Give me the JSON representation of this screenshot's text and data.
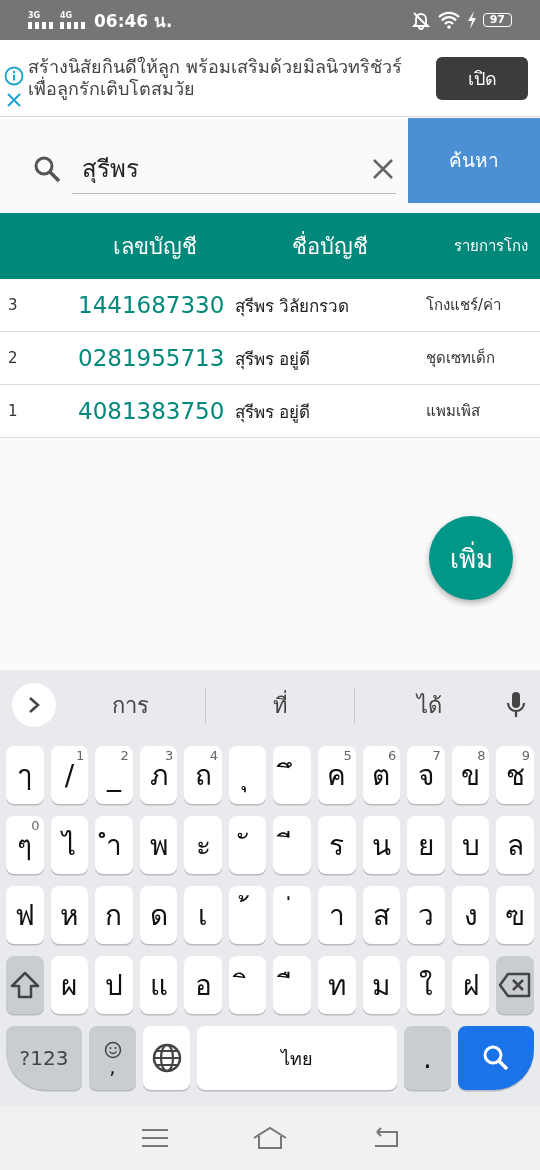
{
  "status_bar": {
    "network_1": "3G",
    "network_2": "4G",
    "time": "06:46 น.",
    "battery": "97"
  },
  "ad": {
    "text": "สร้างนิสัยกินดีให้ลูก พร้อมเสริมด้วยมิลนิวทริชัวร์เพื่อลูกรักเติบโตสมวัย",
    "button": "เปิด"
  },
  "search": {
    "value": "สุรีพร",
    "button": "ค้นหา"
  },
  "table": {
    "columns": [
      "เลขบัญชี",
      "ชื่อบัญชี",
      "รายการโกง"
    ],
    "rows": [
      {
        "no": "3",
        "account": "1441687330",
        "name": "สุรีพร วิลัยกรวด",
        "item": "โกงแชร์/ค่า"
      },
      {
        "no": "2",
        "account": "0281955713",
        "name": "สุรีพร อยู่ดี",
        "item": "ชุดเซทเด็ก"
      },
      {
        "no": "1",
        "account": "4081383750",
        "name": "สุรีพร อยู่ดี",
        "item": "แพมเพิส"
      }
    ]
  },
  "fab": "เพิ่ม",
  "keyboard": {
    "suggestions": [
      "การ",
      "ที่",
      "ได้"
    ],
    "rows": [
      [
        {
          "kind": "char",
          "label": "ๅ"
        },
        {
          "kind": "char",
          "label": "/",
          "hint": "1"
        },
        {
          "kind": "char",
          "label": "_",
          "hint": "2"
        },
        {
          "kind": "char",
          "label": "ภ",
          "hint": "3"
        },
        {
          "kind": "char",
          "label": "ถ",
          "hint": "4"
        },
        {
          "kind": "char",
          "label": "ุ"
        },
        {
          "kind": "char",
          "label": "ึ"
        },
        {
          "kind": "char",
          "label": "ค",
          "hint": "5"
        },
        {
          "kind": "char",
          "label": "ต",
          "hint": "6"
        },
        {
          "kind": "char",
          "label": "จ",
          "hint": "7"
        },
        {
          "kind": "char",
          "label": "ข",
          "hint": "8"
        },
        {
          "kind": "char",
          "label": "ช",
          "hint": "9"
        }
      ],
      [
        {
          "kind": "char",
          "label": "ๆ",
          "hint": "0"
        },
        {
          "kind": "char",
          "label": "ไ"
        },
        {
          "kind": "char",
          "label": "ำ"
        },
        {
          "kind": "char",
          "label": "พ"
        },
        {
          "kind": "char",
          "label": "ะ"
        },
        {
          "kind": "char",
          "label": "ั"
        },
        {
          "kind": "char",
          "label": "ี"
        },
        {
          "kind": "char",
          "label": "ร"
        },
        {
          "kind": "char",
          "label": "น"
        },
        {
          "kind": "char",
          "label": "ย"
        },
        {
          "kind": "char",
          "label": "บ"
        },
        {
          "kind": "char",
          "label": "ล"
        }
      ],
      [
        {
          "kind": "char",
          "label": "ฟ"
        },
        {
          "kind": "char",
          "label": "ห"
        },
        {
          "kind": "char",
          "label": "ก"
        },
        {
          "kind": "char",
          "label": "ด"
        },
        {
          "kind": "char",
          "label": "เ"
        },
        {
          "kind": "char",
          "label": "้"
        },
        {
          "kind": "char",
          "label": "่"
        },
        {
          "kind": "char",
          "label": "า"
        },
        {
          "kind": "char",
          "label": "ส"
        },
        {
          "kind": "char",
          "label": "ว"
        },
        {
          "kind": "char",
          "label": "ง"
        },
        {
          "kind": "char",
          "label": "ฃ"
        }
      ],
      [
        {
          "kind": "shift"
        },
        {
          "kind": "char",
          "label": "ผ"
        },
        {
          "kind": "char",
          "label": "ป"
        },
        {
          "kind": "char",
          "label": "แ"
        },
        {
          "kind": "char",
          "label": "อ"
        },
        {
          "kind": "char",
          "label": "ิ"
        },
        {
          "kind": "char",
          "label": "ื"
        },
        {
          "kind": "char",
          "label": "ท"
        },
        {
          "kind": "char",
          "label": "ม"
        },
        {
          "kind": "char",
          "label": "ใ"
        },
        {
          "kind": "char",
          "label": "ฝ"
        },
        {
          "kind": "backspace"
        }
      ]
    ],
    "bottom": {
      "symbols": "?123",
      "emoji_comma": ",",
      "space": "ไทย",
      "period": "."
    }
  }
}
